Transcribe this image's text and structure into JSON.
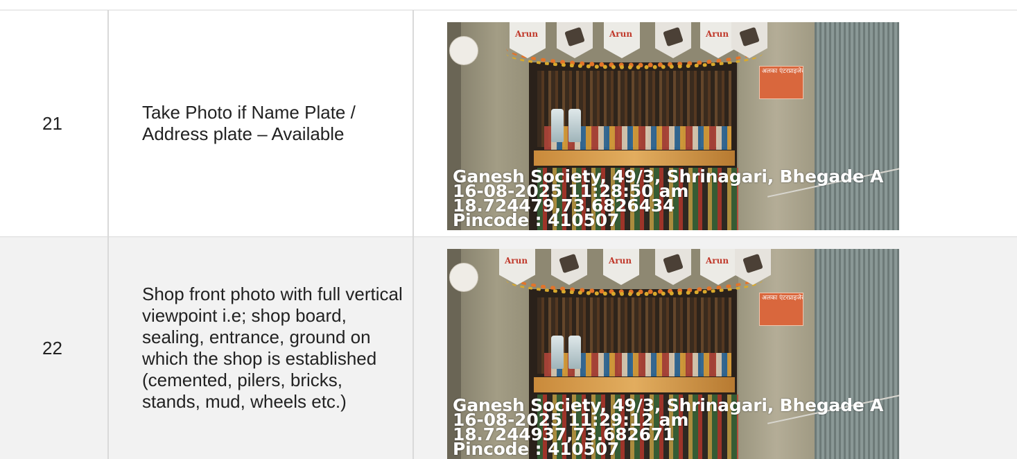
{
  "rows": [
    {
      "no": "21",
      "description": "Take Photo if Name Plate / Address plate – Available",
      "photo": {
        "address": "Ganesh Society, 49/3, Shrinagari, Bhegade A",
        "datetime": "16-08-2025 11:28:50 am",
        "coords": "18.724479,73.6826434",
        "pincode": "Pincode : 410507"
      }
    },
    {
      "no": "22",
      "description": "Shop front photo with full vertical viewpoint i.e; shop board, sealing, entrance, ground on which the shop is established (cemented, pilers, bricks, stands, mud, wheels etc.)",
      "photo": {
        "address": "Ganesh Society, 49/3, Shrinagari, Bhegade A",
        "datetime": "16-08-2025 11:29:12 am",
        "coords": "18.7244937,73.682671",
        "pincode": "Pincode : 410507"
      }
    }
  ],
  "shop_scene": {
    "brand_flag_text": "Arun",
    "plate_title": "अलका एंटरप्राइजेस"
  }
}
